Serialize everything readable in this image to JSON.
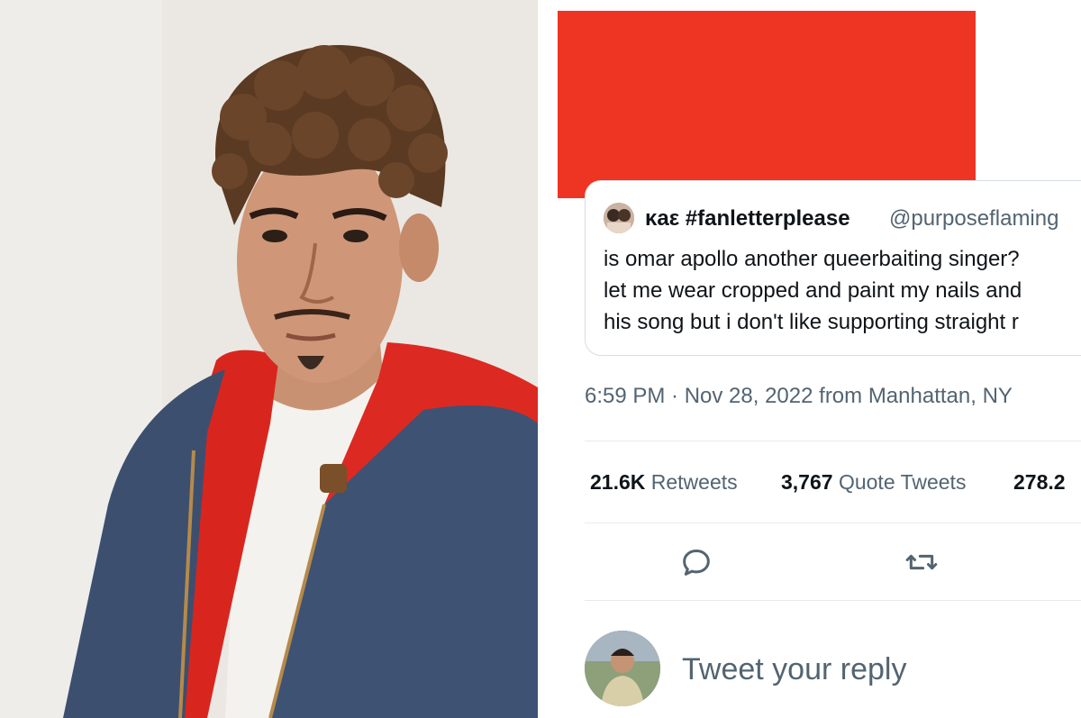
{
  "quoted_tweet": {
    "display_name": "κaε #fanletterplease",
    "handle": "@purposeflaming",
    "lines": [
      "is omar apollo another queerbaiting singer?",
      "let me wear cropped and paint my nails and",
      "his song but i don't like supporting straight r"
    ]
  },
  "meta": {
    "timestamp": "6:59 PM · Nov 28, 2022 from Manhattan, NY"
  },
  "stats": {
    "retweets_count": "21.6K",
    "retweets_label": "Retweets",
    "quotes_count": "3,767",
    "quotes_label": "Quote Tweets",
    "likes_count": "278.2"
  },
  "reply": {
    "placeholder": "Tweet your reply"
  },
  "colors": {
    "redaction": "#ee3524",
    "text_primary": "#0f1419",
    "text_secondary": "#536471",
    "border": "#d7dde2"
  },
  "icons": [
    "reply-icon",
    "retweet-icon"
  ]
}
